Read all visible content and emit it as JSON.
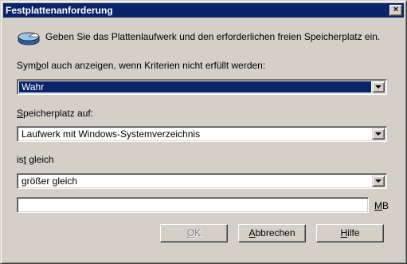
{
  "window": {
    "title": "Festplattenanforderung",
    "close_glyph": "×"
  },
  "intro": {
    "icon": "disk-drive-icon",
    "text": "Geben Sie das Plattenlaufwerk und den erforderlichen freien Speicherplatz ein."
  },
  "show_symbol": {
    "label_pre": "Sym",
    "label_mnemonic": "b",
    "label_post": "ol auch anzeigen, wenn Kriterien nicht erfüllt werden:",
    "value": "Wahr"
  },
  "storage": {
    "label_mnemonic": "S",
    "label_post": "peicherplatz auf:",
    "value": "Laufwerk mit Windows-Systemverzeichnis"
  },
  "comparison": {
    "label_pre": "is",
    "label_mnemonic": "t",
    "label_post": " gleich",
    "value": "größer gleich"
  },
  "size": {
    "value": "",
    "unit_mnemonic": "M",
    "unit_post": "B"
  },
  "buttons": {
    "ok_mnemonic": "O",
    "ok_post": "K",
    "cancel_mnemonic": "A",
    "cancel_post": "bbrechen",
    "help_mnemonic": "H",
    "help_post": "ilfe"
  },
  "colors": {
    "titlebar": "#0a246a",
    "dialog": "#d4d0c8",
    "selection": "#0a246a"
  }
}
